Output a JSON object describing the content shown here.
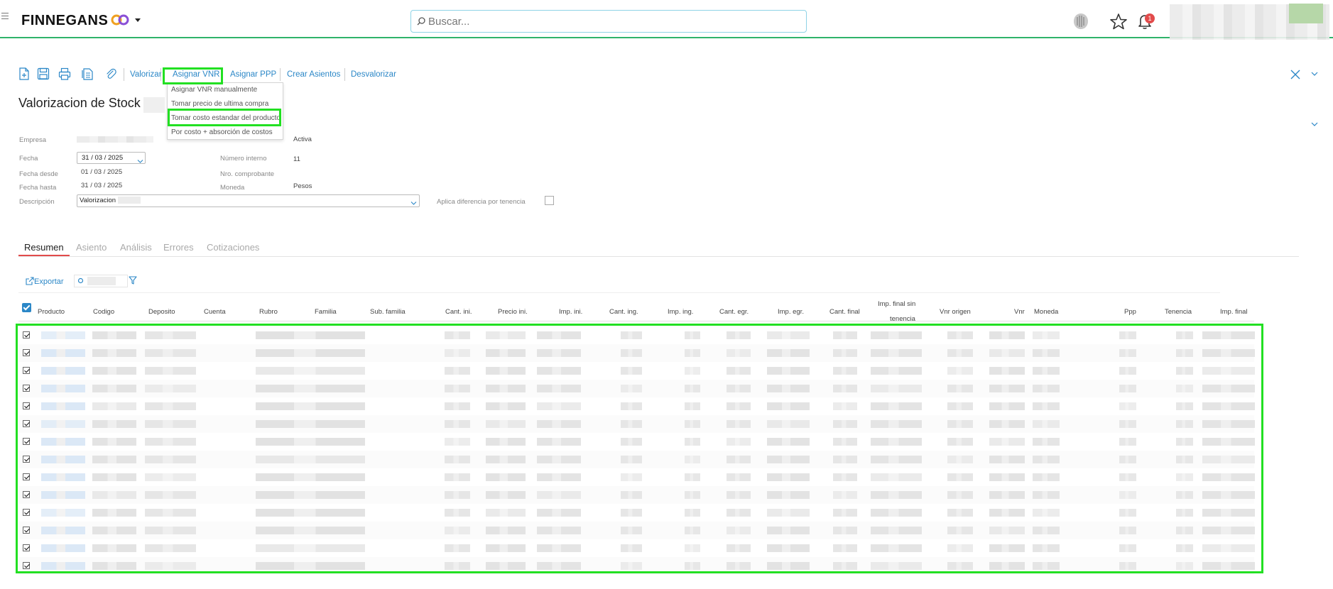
{
  "topbar": {
    "brand": "FINNEGANS",
    "search_placeholder": "Buscar...",
    "notifications_count": "1"
  },
  "toolbar": {
    "actions": [
      "Valorizar",
      "Asignar VNR",
      "Asignar PPP",
      "Crear Asientos",
      "Desvalorizar"
    ]
  },
  "vnr_menu": {
    "items": [
      "Asignar VNR manualmente",
      "Tomar precio de ultima compra",
      "Tomar costo estandar del producto",
      "Por costo + absorción de costos"
    ]
  },
  "form": {
    "title": "Valorizacion de Stock",
    "empresa_label": "Empresa",
    "estado_value": "Activa",
    "fecha_label": "Fecha",
    "fecha_value": "31 / 03 /  2025",
    "numero_interno_label": "Número interno",
    "numero_interno_value": "11",
    "fecha_desde_label": "Fecha desde",
    "fecha_desde_value": "01 / 03 /  2025",
    "nro_comprobante_label": "Nro. comprobante",
    "fecha_hasta_label": "Fecha hasta",
    "fecha_hasta_value": "31 / 03 /  2025",
    "moneda_label": "Moneda",
    "moneda_value": "Pesos",
    "descripcion_label": "Descripción",
    "descripcion_value": "Valorizacion",
    "aplica_label": "Aplica diferencia por tenencia"
  },
  "tabs": [
    "Resumen",
    "Asiento",
    "Análisis",
    "Errores",
    "Cotizaciones"
  ],
  "grid": {
    "export_label": "Exportar",
    "columns": [
      "Producto",
      "Codigo",
      "Deposito",
      "Cuenta",
      "Rubro",
      "Familia",
      "Sub. familia",
      "Cant. ini.",
      "Precio ini.",
      "Imp. ini.",
      "Cant. ing.",
      "Imp. ing.",
      "Cant. egr.",
      "Imp. egr.",
      "Cant. final",
      "Imp. final sin",
      "tenencia",
      "Vnr origen",
      "Vnr",
      "Moneda",
      "Ppp",
      "Tenencia",
      "Imp. final"
    ],
    "row_count": 14
  },
  "colors": {
    "accent": "#2b87c7",
    "brand_green": "#2fb36a",
    "highlight": "#22e022",
    "active_tab": "#e24b4b"
  }
}
